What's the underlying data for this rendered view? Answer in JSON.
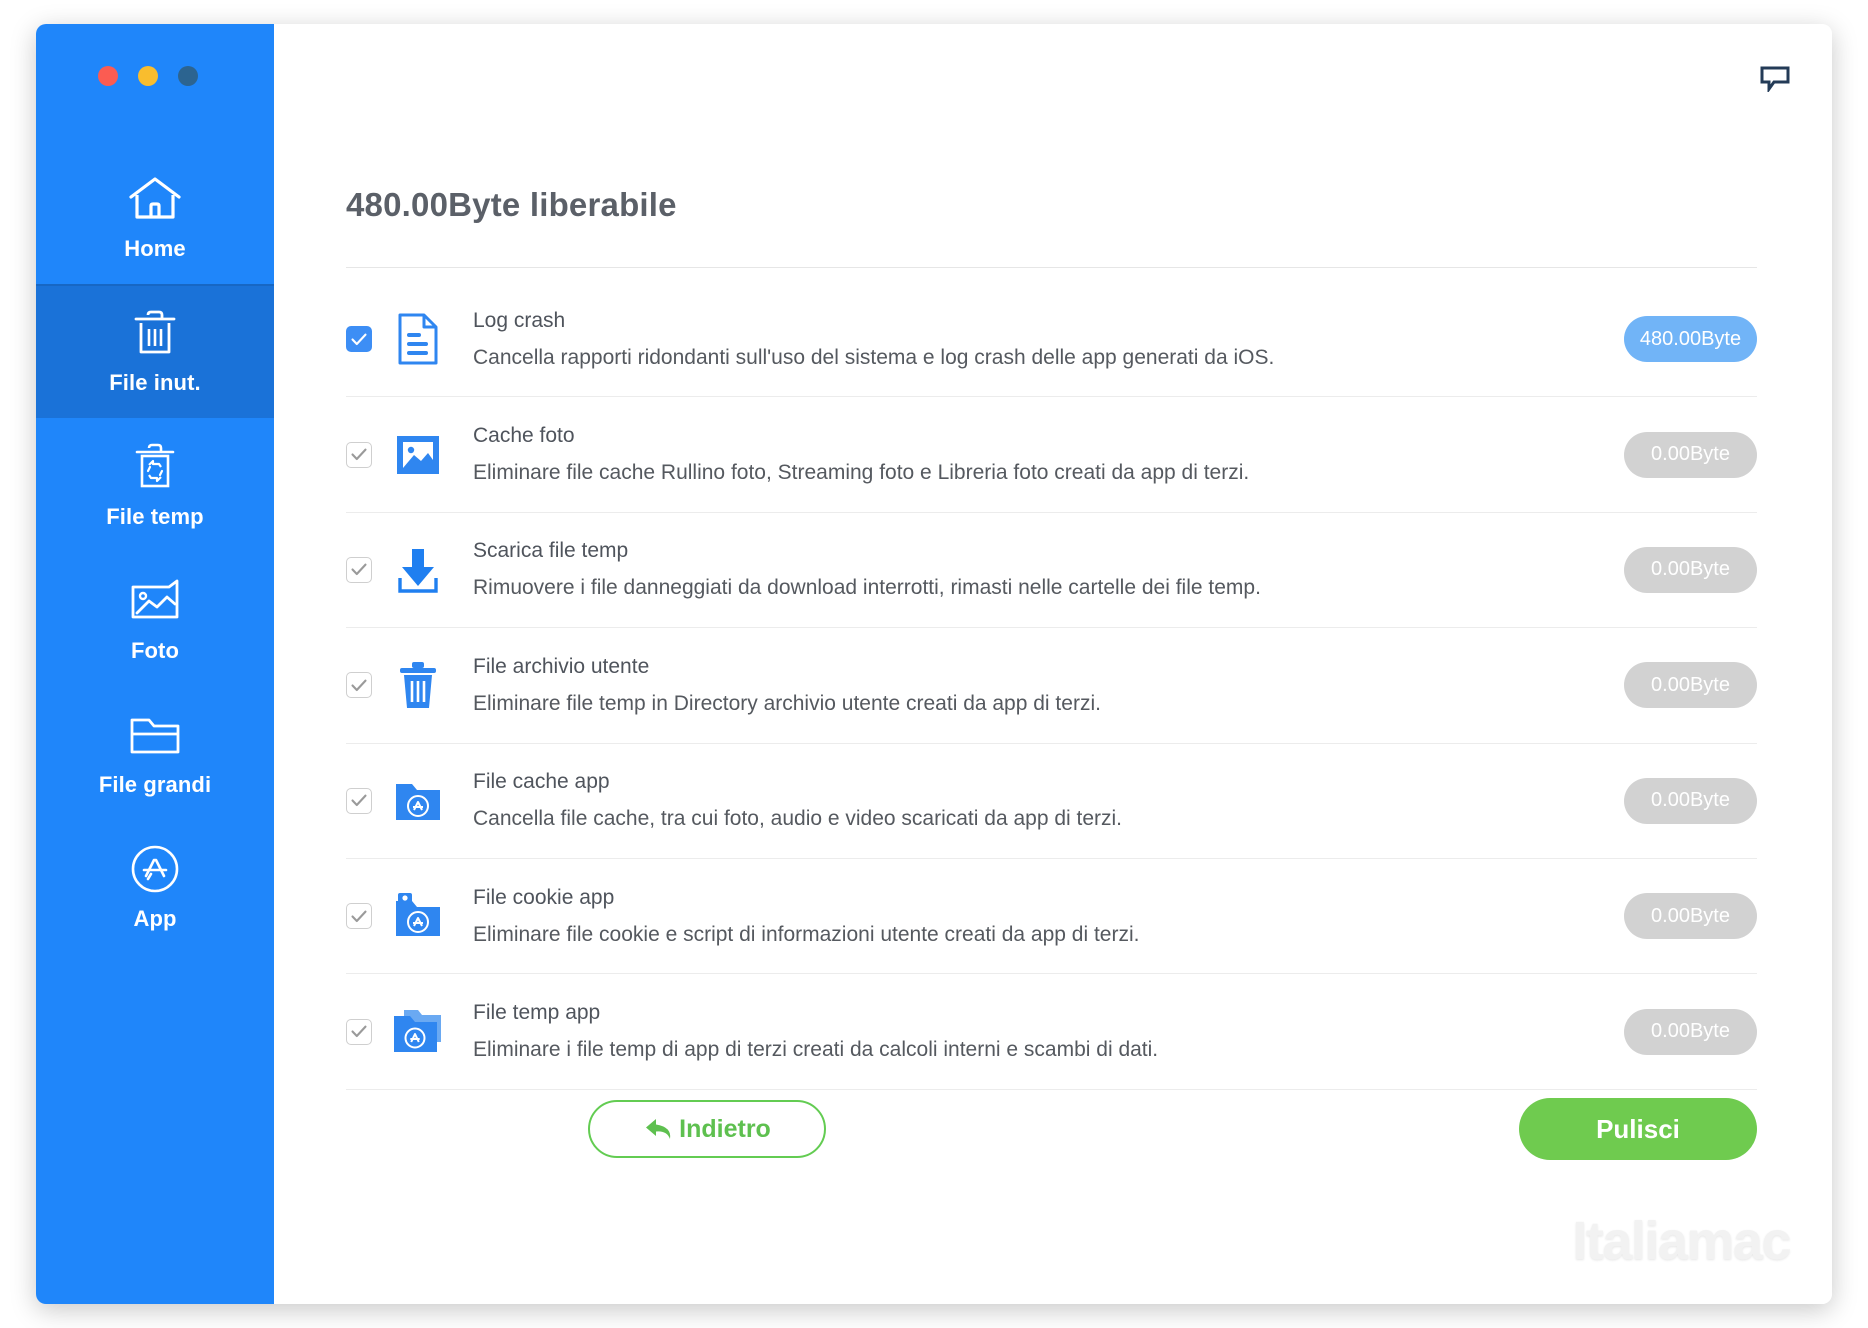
{
  "window": {
    "traffic_lights": [
      {
        "name": "close",
        "color": "#fb5c52"
      },
      {
        "name": "minimize",
        "color": "#f9bd2e"
      },
      {
        "name": "zoom",
        "color": "#2c6490"
      }
    ],
    "accent_blue": "#1f86fa",
    "accent_green": "#6fcb4f"
  },
  "sidebar": {
    "items": [
      {
        "label": "Home",
        "icon": "home-icon",
        "active": false
      },
      {
        "label": "File inut.",
        "icon": "trash-icon",
        "active": true
      },
      {
        "label": "File temp",
        "icon": "recycle-icon",
        "active": false
      },
      {
        "label": "Foto",
        "icon": "photo-icon",
        "active": false
      },
      {
        "label": "File grandi",
        "icon": "folder-icon",
        "active": false
      },
      {
        "label": "App",
        "icon": "appstore-icon",
        "active": false
      }
    ]
  },
  "header": {
    "title": "480.00Byte liberabile",
    "feedback_icon": "speech-bubble-icon"
  },
  "list": {
    "rows": [
      {
        "title": "Log crash",
        "description": "Cancella rapporti ridondanti sull'uso del sistema e log crash delle app generati da iOS.",
        "size": "480.00Byte",
        "checked": true,
        "highlighted": true,
        "icon": "document-icon"
      },
      {
        "title": "Cache foto",
        "description": "Eliminare file cache Rullino foto, Streaming foto e Libreria foto creati da app di terzi.",
        "size": "0.00Byte",
        "checked": true,
        "highlighted": false,
        "icon": "image-icon"
      },
      {
        "title": "Scarica file temp",
        "description": "Rimuovere i file danneggiati da download interrotti, rimasti nelle cartelle dei file temp.",
        "size": "0.00Byte",
        "checked": true,
        "highlighted": false,
        "icon": "download-icon"
      },
      {
        "title": "File archivio utente",
        "description": "Eliminare file temp in Directory archivio utente creati da app di terzi.",
        "size": "0.00Byte",
        "checked": true,
        "highlighted": false,
        "icon": "trash-blue-icon"
      },
      {
        "title": "File cache app",
        "description": "Cancella file cache, tra cui foto, audio e video scaricati da app di terzi.",
        "size": "0.00Byte",
        "checked": true,
        "highlighted": false,
        "icon": "app-folder-icon"
      },
      {
        "title": "File cookie app",
        "description": "Eliminare file cookie e script di informazioni utente creati da app di terzi.",
        "size": "0.00Byte",
        "checked": true,
        "highlighted": false,
        "icon": "app-cookie-folder-icon"
      },
      {
        "title": "File temp app",
        "description": "Eliminare i file temp di app di terzi creati da calcoli interni e scambi di dati.",
        "size": "0.00Byte",
        "checked": true,
        "highlighted": false,
        "icon": "app-temp-folder-icon"
      }
    ]
  },
  "footer": {
    "back_label": "Indietro",
    "back_icon": "back-arrow-icon",
    "clean_label": "Pulisci"
  },
  "watermark": {
    "text": "Italiamac"
  }
}
